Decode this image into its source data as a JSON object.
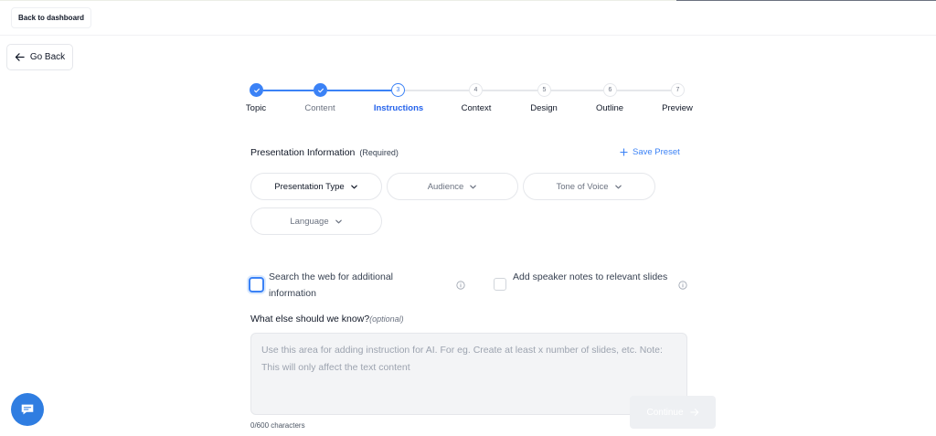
{
  "header": {
    "back_to_dashboard": "Back to dashboard"
  },
  "nav": {
    "go_back": "Go Back"
  },
  "stepper": {
    "steps": [
      {
        "number": "1",
        "label": "Topic",
        "state": "done"
      },
      {
        "number": "2",
        "label": "Content",
        "state": "done"
      },
      {
        "number": "3",
        "label": "Instructions",
        "state": "active"
      },
      {
        "number": "4",
        "label": "Context",
        "state": "pending"
      },
      {
        "number": "5",
        "label": "Design",
        "state": "pending"
      },
      {
        "number": "6",
        "label": "Outline",
        "state": "pending"
      },
      {
        "number": "7",
        "label": "Preview",
        "state": "pending"
      }
    ]
  },
  "presentation_info": {
    "title": "Presentation Information",
    "required": "(Required)",
    "save_preset": "Save Preset",
    "dropdowns": {
      "type": "Presentation Type",
      "audience": "Audience",
      "tone": "Tone of Voice",
      "language": "Language"
    }
  },
  "options": {
    "search_web": "Search the web for additional information",
    "speaker_notes": "Add speaker notes to relevant slides"
  },
  "instructions": {
    "question": "What else should we know?",
    "optional": "(optional)",
    "placeholder": "Use this area for adding instruction for AI. For eg. Create at least x number of slides, etc. Note: This will only affect the text content",
    "char_count": "0/600 characters"
  },
  "actions": {
    "continue": "Continue"
  },
  "colors": {
    "accent": "#3b82f6",
    "chat": "#2f7de1"
  }
}
